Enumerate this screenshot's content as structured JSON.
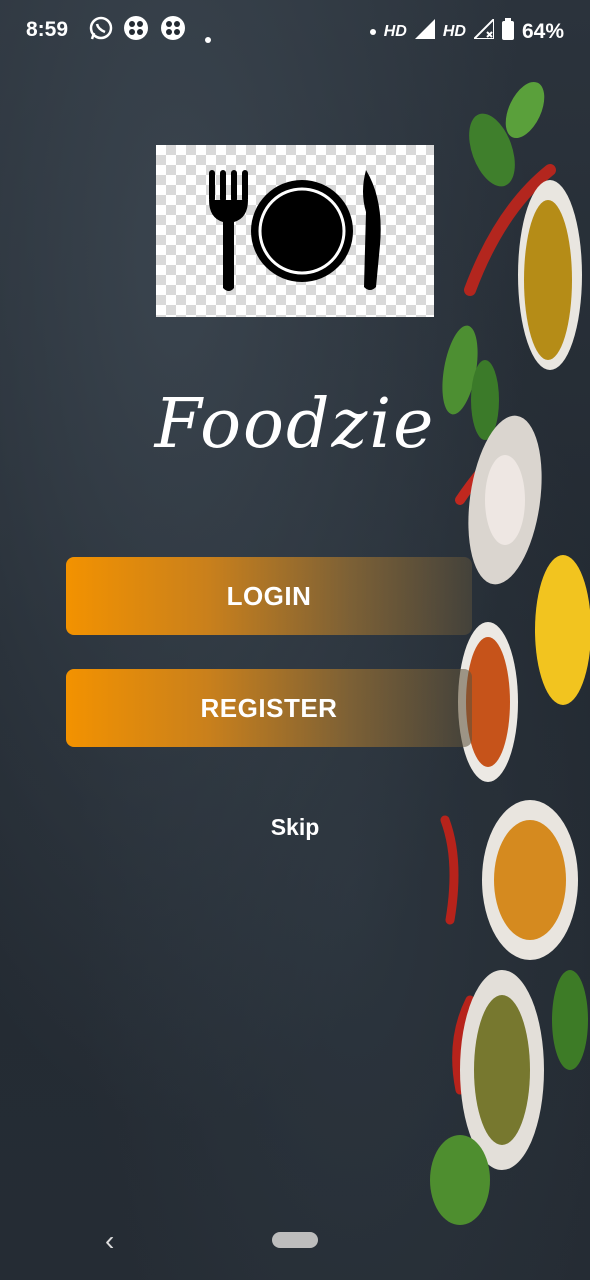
{
  "status_bar": {
    "time": "8:59",
    "network_left": "HD",
    "network_right": "HD",
    "battery": "64%",
    "icons": [
      "whatsapp-icon",
      "app-notification-icon",
      "app-notification-icon",
      "dot-icon",
      "dot-icon",
      "signal-icon",
      "signal-icon",
      "battery-icon"
    ]
  },
  "app": {
    "title": "Foodzie",
    "logo_icon": "fork-plate-knife-icon"
  },
  "buttons": {
    "login_label": "LOGIN",
    "register_label": "REGISTER",
    "skip_label": "Skip"
  },
  "colors": {
    "accent": "#f39200",
    "background": "#262d35",
    "text": "#ffffff"
  },
  "nav_bar": {
    "back_icon": "chevron-left-icon",
    "home_icon": "home-pill-icon"
  }
}
